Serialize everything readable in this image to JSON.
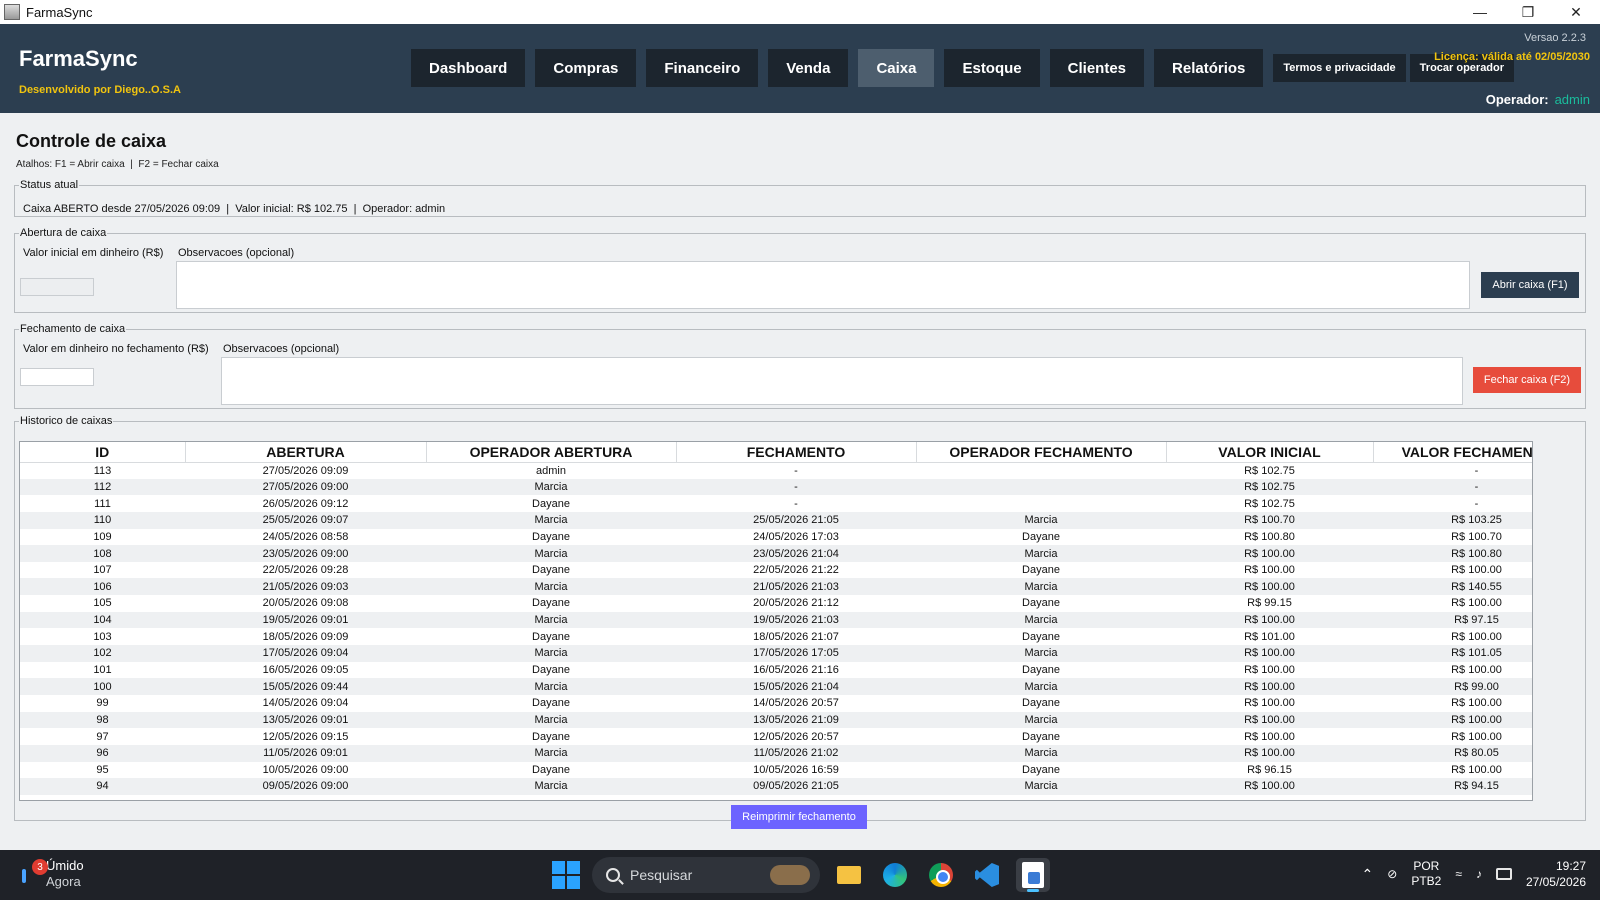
{
  "window": {
    "title": "FarmaSync"
  },
  "header": {
    "brand": "FarmaSync",
    "subtitle": "Desenvolvido por Diego..O.S.A",
    "version": "Versao 2.2.3",
    "license": "Licença: válida até 02/05/2030",
    "operator_label": "Operador:",
    "operator_value": "admin",
    "tabs": [
      "Dashboard",
      "Compras",
      "Financeiro",
      "Venda",
      "Caixa",
      "Estoque",
      "Clientes",
      "Relatórios"
    ],
    "active_tab": "Caixa",
    "links": [
      "Termos e privacidade",
      "Trocar operador"
    ]
  },
  "page": {
    "title": "Controle de caixa",
    "shortcuts": "Atalhos: F1 = Abrir caixa  |  F2 = Fechar caixa"
  },
  "status": {
    "legend": "Status atual",
    "text": "Caixa ABERTO desde 27/05/2026 09:09  |  Valor inicial: R$ 102.75  |  Operador: admin"
  },
  "abertura": {
    "legend": "Abertura de caixa",
    "valor_label": "Valor inicial em dinheiro (R$)",
    "valor_value": "",
    "obs_label": "Observacoes (opcional)",
    "obs_value": "",
    "button": "Abrir caixa (F1)"
  },
  "fechamento": {
    "legend": "Fechamento de caixa",
    "valor_label": "Valor em dinheiro no fechamento (R$)",
    "valor_value": "",
    "obs_label": "Observacoes (opcional)",
    "obs_value": "",
    "button": "Fechar caixa (F2)"
  },
  "historico": {
    "legend": "Historico de caixas",
    "columns": [
      "ID",
      "ABERTURA",
      "OPERADOR ABERTURA",
      "FECHAMENTO",
      "OPERADOR FECHAMENTO",
      "VALOR INICIAL",
      "VALOR FECHAMENTO"
    ],
    "rows": [
      [
        "113",
        "27/05/2026 09:09",
        "admin",
        "-",
        "",
        "R$ 102.75",
        "-"
      ],
      [
        "112",
        "27/05/2026 09:00",
        "Marcia",
        "-",
        "",
        "R$ 102.75",
        "-"
      ],
      [
        "111",
        "26/05/2026 09:12",
        "Dayane",
        "-",
        "",
        "R$ 102.75",
        "-"
      ],
      [
        "110",
        "25/05/2026 09:07",
        "Marcia",
        "25/05/2026 21:05",
        "Marcia",
        "R$ 100.70",
        "R$ 103.25"
      ],
      [
        "109",
        "24/05/2026 08:58",
        "Dayane",
        "24/05/2026 17:03",
        "Dayane",
        "R$ 100.80",
        "R$ 100.70"
      ],
      [
        "108",
        "23/05/2026 09:00",
        "Marcia",
        "23/05/2026 21:04",
        "Marcia",
        "R$ 100.00",
        "R$ 100.80"
      ],
      [
        "107",
        "22/05/2026 09:28",
        "Dayane",
        "22/05/2026 21:22",
        "Dayane",
        "R$ 100.00",
        "R$ 100.00"
      ],
      [
        "106",
        "21/05/2026 09:03",
        "Marcia",
        "21/05/2026 21:03",
        "Marcia",
        "R$ 100.00",
        "R$ 140.55"
      ],
      [
        "105",
        "20/05/2026 09:08",
        "Dayane",
        "20/05/2026 21:12",
        "Dayane",
        "R$ 99.15",
        "R$ 100.00"
      ],
      [
        "104",
        "19/05/2026 09:01",
        "Marcia",
        "19/05/2026 21:03",
        "Marcia",
        "R$ 100.00",
        "R$ 97.15"
      ],
      [
        "103",
        "18/05/2026 09:09",
        "Dayane",
        "18/05/2026 21:07",
        "Dayane",
        "R$ 101.00",
        "R$ 100.00"
      ],
      [
        "102",
        "17/05/2026 09:04",
        "Marcia",
        "17/05/2026 17:05",
        "Marcia",
        "R$ 100.00",
        "R$ 101.05"
      ],
      [
        "101",
        "16/05/2026 09:05",
        "Dayane",
        "16/05/2026 21:16",
        "Dayane",
        "R$ 100.00",
        "R$ 100.00"
      ],
      [
        "100",
        "15/05/2026 09:44",
        "Marcia",
        "15/05/2026 21:04",
        "Marcia",
        "R$ 100.00",
        "R$ 99.00"
      ],
      [
        "99",
        "14/05/2026 09:04",
        "Dayane",
        "14/05/2026 20:57",
        "Dayane",
        "R$ 100.00",
        "R$ 100.00"
      ],
      [
        "98",
        "13/05/2026 09:01",
        "Marcia",
        "13/05/2026 21:09",
        "Marcia",
        "R$ 100.00",
        "R$ 100.00"
      ],
      [
        "97",
        "12/05/2026 09:15",
        "Dayane",
        "12/05/2026 20:57",
        "Dayane",
        "R$ 100.00",
        "R$ 100.00"
      ],
      [
        "96",
        "11/05/2026 09:01",
        "Marcia",
        "11/05/2026 21:02",
        "Marcia",
        "R$ 100.00",
        "R$ 80.05"
      ],
      [
        "95",
        "10/05/2026 09:00",
        "Dayane",
        "10/05/2026 16:59",
        "Dayane",
        "R$ 96.15",
        "R$ 100.00"
      ],
      [
        "94",
        "09/05/2026 09:00",
        "Marcia",
        "09/05/2026 21:05",
        "Marcia",
        "R$ 100.00",
        "R$ 94.15"
      ]
    ],
    "reprint_button": "Reimprimir fechamento"
  },
  "taskbar": {
    "weather_text": "Úmido",
    "weather_sub": "Agora",
    "weather_badge": "3",
    "search_placeholder": "Pesquisar",
    "lang": "POR",
    "lang_sub": "PTB2",
    "time": "19:27",
    "date": "27/05/2026"
  },
  "colors": {
    "header_bg": "#2c3e50",
    "tab_bg": "#1c252e",
    "tab_active_bg": "#4d5e6e",
    "accent_yellow": "#f1c40f",
    "operator_green": "#1abc9c",
    "open_button": "#2c3e50",
    "close_button": "#e74c3c",
    "reprint_button": "#6c63ff"
  }
}
